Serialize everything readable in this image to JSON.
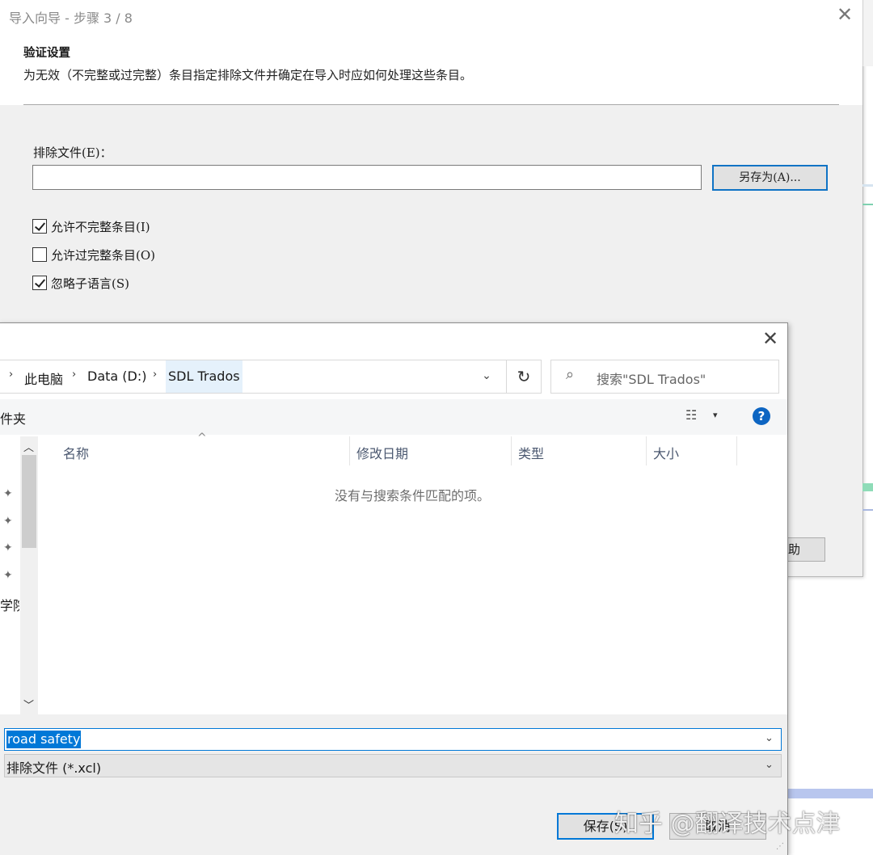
{
  "wizard": {
    "title": "导入向导 - 步骤 3 / 8",
    "close_glyph": "✕",
    "heading": "验证设置",
    "description": "为无效（不完整或过完整）条目指定排除文件并确定在导入时应如何处理这些条目。",
    "exclusion_label": "排除文件(E)：",
    "exclusion_value": "",
    "save_as_label": "另存为(A)...",
    "checkboxes": [
      {
        "label": "允许不完整条目(I)",
        "checked": true
      },
      {
        "label": "允许过完整条目(O)",
        "checked": false
      },
      {
        "label": "忽略子语言(S)",
        "checked": true
      }
    ],
    "help_label": "助"
  },
  "dialog": {
    "close_glyph": "✕",
    "breadcrumb": [
      "此电脑",
      "Data (D:)",
      "SDL Trados"
    ],
    "search_placeholder": "搜索\"SDL Trados\"",
    "new_folder_label": "件夹",
    "help_glyph": "?",
    "nav_label": "学院",
    "columns": [
      "名称",
      "修改日期",
      "类型",
      "大小"
    ],
    "empty_message": "没有与搜索条件匹配的项。",
    "filename_value": "road safety",
    "filetype_value": "排除文件 (*.xcl)",
    "save_label": "保存(S)",
    "cancel_label": "取消"
  },
  "icons": {
    "chevron_down": "⌄",
    "breadcrumb_sep": "›",
    "refresh": "↻",
    "search": "⌕",
    "pin": "✦",
    "scroll_up": "︿",
    "scroll_down": "﹀",
    "sort_caret": "^",
    "view": "☷",
    "view_drop": "▾"
  },
  "watermark": "知乎 @翻译技术点津",
  "colors": {
    "accent": "#0078d7",
    "help_blue": "#0d65c2",
    "selection_bg": "#0078d7",
    "breadcrumb_active_bg": "#e5f1fb"
  }
}
